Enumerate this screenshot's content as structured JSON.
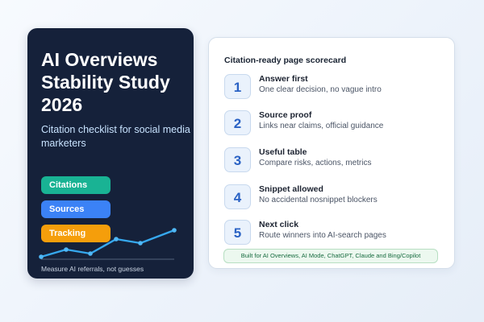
{
  "hero": {
    "title": "AI Overviews Stability Study 2026",
    "subtitle": "Citation checklist for social media marketers",
    "pills": [
      {
        "label": "Citations",
        "color": "#19b394"
      },
      {
        "label": "Sources",
        "color": "#3b82f6"
      },
      {
        "label": "Tracking",
        "color": "#f59e0b"
      }
    ],
    "footnote": "Measure AI referrals, not guesses",
    "background_color": "#15213a"
  },
  "scorecard": {
    "title": "Citation-ready page scorecard",
    "steps": [
      {
        "number": "1",
        "title": "Answer first",
        "description": "One clear decision, no vague intro"
      },
      {
        "number": "2",
        "title": "Source proof",
        "description": "Links near claims, official guidance"
      },
      {
        "number": "3",
        "title": "Useful table",
        "description": "Compare risks, actions, metrics"
      },
      {
        "number": "4",
        "title": "Snippet allowed",
        "description": "No accidental nosnippet blockers"
      },
      {
        "number": "5",
        "title": "Next click",
        "description": "Route winners into AI-search pages"
      }
    ],
    "note": "Built for AI Overviews, AI Mode, ChatGPT, Claude and Bing/Copilot"
  }
}
